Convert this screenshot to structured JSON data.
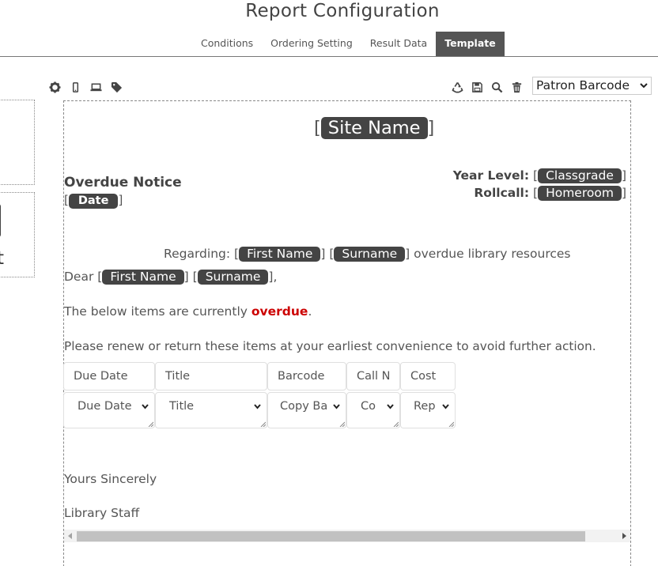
{
  "header": {
    "title": "Report Configuration",
    "tabs": [
      {
        "label": "Conditions",
        "active": false
      },
      {
        "label": "Ordering Setting",
        "active": false
      },
      {
        "label": "Result Data",
        "active": false
      },
      {
        "label": "Template",
        "active": true
      }
    ]
  },
  "toolbar": {
    "left_icons": [
      "gear-icon",
      "mobile-icon",
      "laptop-icon",
      "tag-icon"
    ],
    "right_icons": [
      "recycle-icon",
      "save-icon",
      "search-icon",
      "trash-icon"
    ],
    "barcode_select": "Patron Barcode"
  },
  "left_panel": {
    "partial_char": "t"
  },
  "template": {
    "site_name": "Site Name",
    "notice_title": "Overdue Notice",
    "date_tag": "Date",
    "year_level_label": "Year Level:",
    "year_level_tag": "Classgrade",
    "rollcall_label": "Rollcall:",
    "rollcall_tag": "Homeroom",
    "regarding_label": "Regarding:",
    "first_name_tag": "First Name",
    "surname_tag": "Surname",
    "regarding_suffix": "overdue library resources",
    "dear_label": "Dear",
    "below_prefix": "The below items are currently",
    "below_highlight": "overdue",
    "below_suffix": ".",
    "renew_text": "Please renew or return these items at your earliest convenience to avoid further action.",
    "table_headers": [
      "Due Date",
      "Title",
      "Barcode",
      "Call N",
      "Cost"
    ],
    "table_selects": [
      "Due Date",
      "Title",
      "Copy Ba",
      "Co",
      "Rep"
    ],
    "closing": "Yours Sincerely",
    "signature": "Library Staff"
  },
  "colors": {
    "tag_bg": "#444444",
    "overdue": "#cc0000",
    "active_tab": "#555555"
  }
}
